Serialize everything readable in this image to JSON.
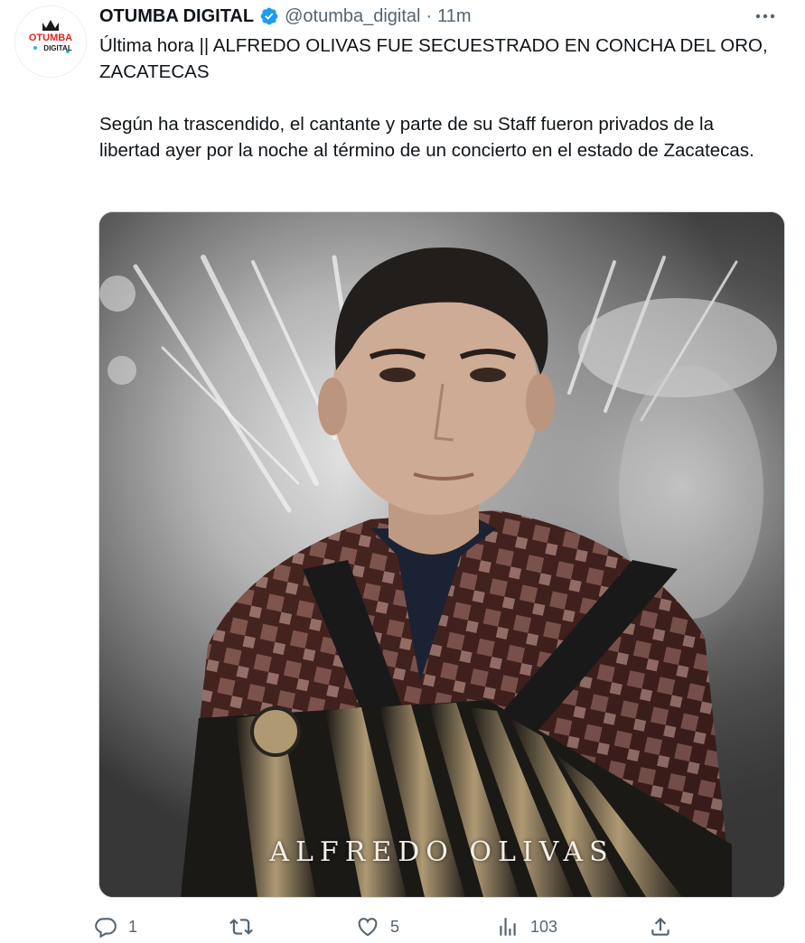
{
  "tweet": {
    "display_name": "OTUMBA DIGITAL",
    "handle": "@otumba_digital",
    "separator": "·",
    "time": "11m",
    "verified": true,
    "avatar_text_top": "OTUMBA",
    "avatar_text_bottom": "DIGITAL",
    "paragraphs": [
      "Última hora || ALFREDO OLIVAS FUE SECUESTRADO EN CONCHA DEL ORO, ZACATECAS",
      "Según ha trascendido, el cantante y parte de su Staff fueron privados de la libertad ayer por la noche al término de un concierto en el estado de Zacatecas."
    ],
    "media_caption": "ALFREDO OLIVAS",
    "actions": {
      "replies": "1",
      "retweets": "",
      "likes": "5",
      "views": "103"
    },
    "icons": {
      "verified": "verified-badge-icon",
      "more": "more-icon",
      "reply": "reply-icon",
      "retweet": "retweet-icon",
      "like": "like-icon",
      "views": "views-icon",
      "share": "share-icon"
    },
    "colors": {
      "verified": "#1d9bf0",
      "text": "#0f1419",
      "muted": "#536471",
      "logo_red": "#e0261f"
    }
  }
}
